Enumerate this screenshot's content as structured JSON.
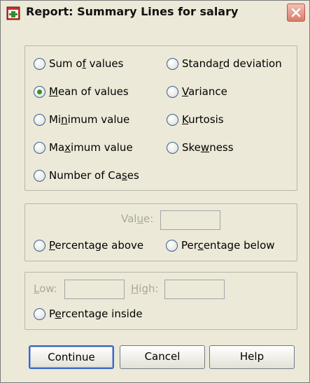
{
  "window": {
    "title": "Report: Summary Lines for salary",
    "icon": "report-app-icon"
  },
  "summary_options": {
    "sum": {
      "pre": "Sum o",
      "ul": "f",
      "post": " values",
      "selected": false
    },
    "mean": {
      "pre": "",
      "ul": "M",
      "post": "ean of values",
      "selected": true
    },
    "minimum": {
      "pre": "Mi",
      "ul": "n",
      "post": "imum value",
      "selected": false
    },
    "maximum": {
      "pre": "Ma",
      "ul": "x",
      "post": "imum value",
      "selected": false
    },
    "cases": {
      "pre": "Number of Ca",
      "ul": "s",
      "post": "es",
      "selected": false
    },
    "stddev": {
      "pre": "Standa",
      "ul": "r",
      "post": "d deviation",
      "selected": false
    },
    "variance": {
      "pre": "",
      "ul": "V",
      "post": "ariance",
      "selected": false
    },
    "kurtosis": {
      "pre": "",
      "ul": "K",
      "post": "urtosis",
      "selected": false
    },
    "skewness": {
      "pre": "Ske",
      "ul": "w",
      "post": "ness",
      "selected": false
    }
  },
  "percentage_group": {
    "value_label": {
      "pre": "Val",
      "ul": "u",
      "post": "e:"
    },
    "value": "",
    "above": {
      "pre": "",
      "ul": "P",
      "post": "ercentage above",
      "selected": false
    },
    "below": {
      "pre": "Per",
      "ul": "c",
      "post": "entage below",
      "selected": false
    }
  },
  "range_group": {
    "low_label": {
      "pre": "",
      "ul": "L",
      "post": "ow:"
    },
    "low_value": "",
    "high_label": {
      "pre": "",
      "ul": "H",
      "post": "igh:"
    },
    "high_value": "",
    "inside": {
      "pre": "P",
      "ul": "e",
      "post": "rcentage inside",
      "selected": false
    }
  },
  "buttons": {
    "continue": "Continue",
    "cancel": "Cancel",
    "help": "Help"
  },
  "colors": {
    "dialog_bg": "#ece9d8",
    "radio_selected": "#3a8e2a",
    "close_button": "#d97c6a",
    "default_button_border": "#3a66c9"
  }
}
